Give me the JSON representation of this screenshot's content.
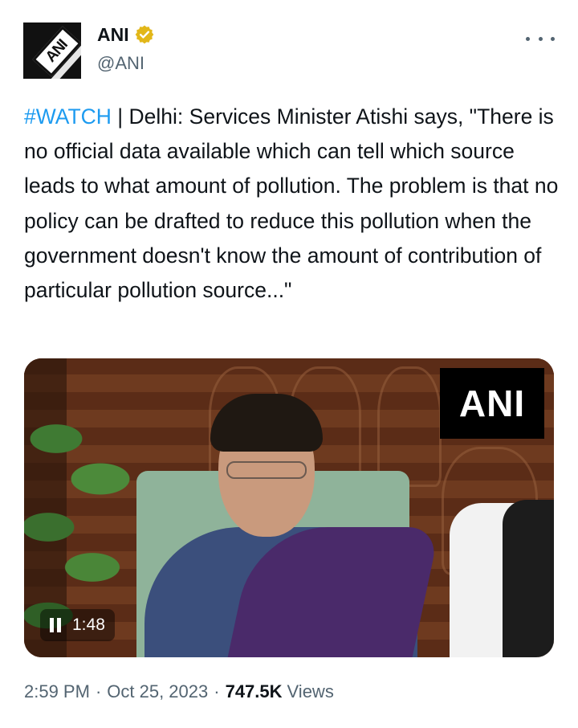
{
  "author": {
    "display_name": "ANI",
    "handle": "@ANI",
    "avatar_text": "ANI"
  },
  "tweet": {
    "hashtag": "#WATCH",
    "text": " | Delhi: Services Minister Atishi says, \"There is no official data available which can tell which source leads to what amount of pollution. The problem is that no policy can be drafted to reduce this pollution when the government doesn't know the amount of contribution of particular pollution source...\""
  },
  "media": {
    "watermark": "ANI",
    "duration": "1:48"
  },
  "meta": {
    "time": "2:59 PM",
    "separator": "·",
    "date": "Oct 25, 2023",
    "views_count": "747.5K",
    "views_label": "Views"
  },
  "colors": {
    "link": "#1d9bf0",
    "verified_badge": "#e2b719",
    "secondary_text": "#536471"
  },
  "icons": {
    "verified": "verified-badge-icon",
    "more": "more-horizontal-icon",
    "pause": "pause-icon"
  }
}
